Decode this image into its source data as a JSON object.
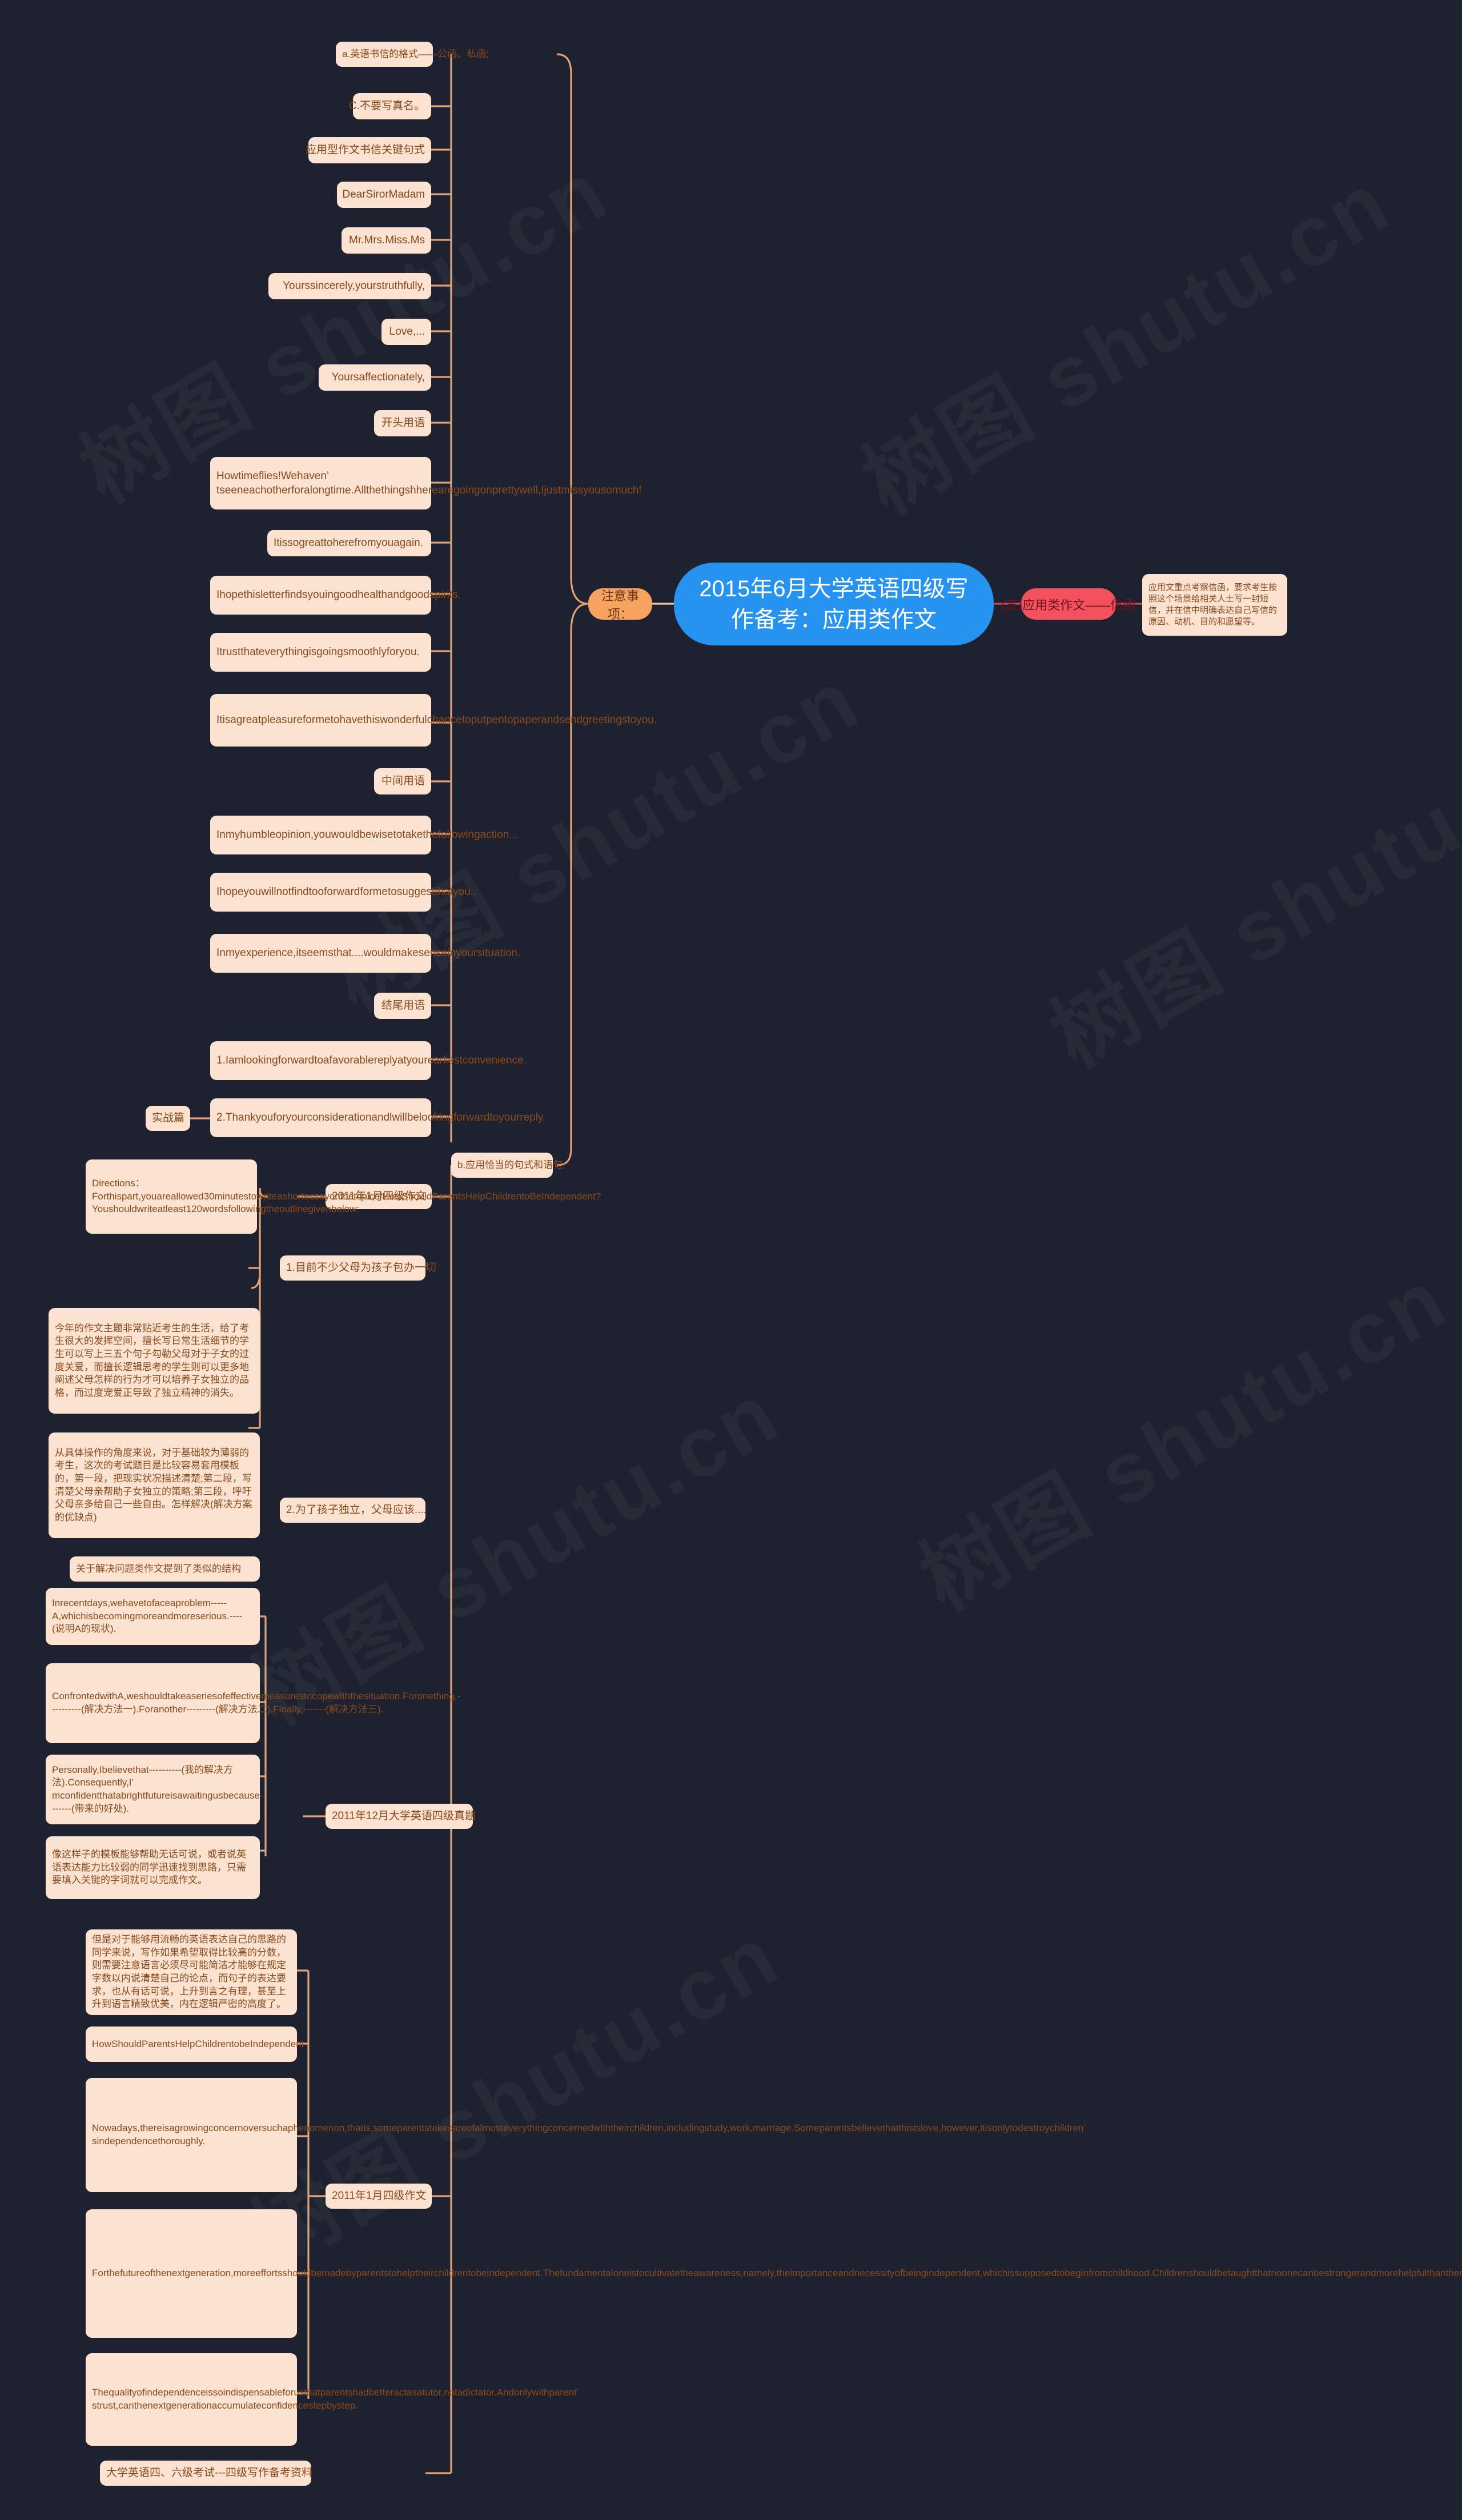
{
  "meta": {
    "background": "#1e2230",
    "root_color": "#2693f0",
    "branch_orange": "#f6a35f",
    "branch_red": "#f4515f",
    "card_bg": "#fce3d1",
    "card_text": "#8a4a1c",
    "link_orange": "#e2a273",
    "link_red": "#d9434f",
    "watermark": "树图 shutu.cn"
  },
  "root": {
    "title": "2015年6月大学英语四级写作备考：应用类作文"
  },
  "branches": {
    "notes": "注意事项：",
    "applied": "(五)应用类作文——信函"
  },
  "right_card": {
    "text": "应用文重点考察信函，要求考生按照这个场景给相关人士写一封短信，并在信中明确表达自己写信的原因、动机、目的和愿望等。"
  },
  "sub_branches": {
    "format": "a.英语书信的格式——公函、私函;",
    "sentences": "b.应用恰当的句式和语句;"
  },
  "format_children": [
    {
      "text": "C.不要写真名。"
    },
    {
      "text": "应用型作文书信关键句式"
    },
    {
      "text": "DearSirorMadam"
    },
    {
      "text": "Mr.Mrs.Miss.Ms"
    },
    {
      "text": "Yourssincerely,yourstruthfully,"
    },
    {
      "text": "Love,..."
    },
    {
      "text": "Yoursaffectionately,"
    },
    {
      "text": "开头用语"
    },
    {
      "text": "Howtimeflies!Wehaven’ tseeneachotherforalongtime.Allthethingshherearegoingonprettywell,Ijustmissyousomuch!"
    },
    {
      "text": "Itissogreattoherefromyouagain."
    },
    {
      "text": "Ihopethisletterfindsyouingoodhealthandgoodspirits."
    },
    {
      "text": "Itrustthateverythingisgoingsmoothlyforyou."
    },
    {
      "text": "Itisagreatpleasureformetohavethiswonderfulchancetoputpentopaperandsendgreetingstoyou."
    },
    {
      "text": "中间用语"
    },
    {
      "text": "Inmyhumbleopinion,youwouldbewisetotakethefollowingaction..."
    },
    {
      "text": "Ihopeyouwillnotfindtooforwardformetosuggestthatyou.."
    },
    {
      "text": "Inmyexperience,itseemsthat....wouldmakesenseinyoursituation."
    },
    {
      "text": "结尾用语"
    },
    {
      "text": "1.Iamlookingforwardtoafavorablereplyatyourearliestconvenience."
    },
    {
      "text": "2.Thankyouforyourconsiderationandlwillbelookingforwardtoyourreply."
    }
  ],
  "practice": {
    "label": "实战篇"
  },
  "exam_2011_01_a": {
    "label": "2011年1月四级作文"
  },
  "exam_2011_12": {
    "label": "2011年12月大学英语四级真题"
  },
  "exam_2011_01_b": {
    "label": "2011年1月四级作文"
  },
  "bottom": {
    "label": "大学英语四、六级考试---四级写作备考资料"
  },
  "exam_2011_01_a_children": [
    {
      "text": "Directions：Forthispart,youareallowed30minutestowriteashortessayonthetopicofHowShouldParentsHelpChildrentoBeIndependent?Youshouldwriteatleast120wordsfollowingtheoutlinegivenbelow:"
    },
    {
      "text": "1.目前不少父母为孩子包办一切"
    },
    {
      "text": "今年的作文主题非常贴近考生的生活，给了考生很大的发挥空间，擅长写日常生活细节的学生可以写上三五个句子勾勒父母对于子女的过度关爱，而擅长逻辑思考的学生则可以更多地阐述父母怎样的行为才可以培养子女独立的品格，而过度宠爱正导致了独立精神的消失。"
    },
    {
      "text": "从具体操作的角度来说，对于基础较为薄弱的考生，这次的考试题目是比较容易套用模板的，第一段，把现实状况描述清楚;第二段，写清楚父母亲帮助子女独立的策略;第三段，呼吁父母亲多给自己一些自由。怎样解决(解决方案的优缺点)"
    },
    {
      "text": "2.为了孩子独立，父母应该...."
    },
    {
      "text": "关于解决问题类作文提到了类似的结构"
    }
  ],
  "exam_2011_12_children": [
    {
      "text": "Inrecentdays,wehavetofaceaproblem-----A,whichisbecomingmoreandmoreserious.----(说明A的现状)."
    },
    {
      "text": "ConfrontedwithA,weshouldtakeaseriesofeffectivemeasurestocopewiththesituation.Foronething,----------(解决方法一).Foranother---------(解决方法二).Finally,-------(解决方法三)."
    },
    {
      "text": "Personally,Ibelievethat----------(我的解决方法).Consequently,I’ mconfidentthatabrightfutureisawaitingusbecause-------(带来的好处)."
    },
    {
      "text": "像这样子的模板能够帮助无话可说，或者说英语表达能力比较弱的同学迅速找到思路，只需要填入关键的字词就可以完成作文。"
    }
  ],
  "exam_2011_01_b_children": [
    {
      "text": "但是对于能够用流畅的英语表达自己的思路的同学来说，写作如果希望取得比较高的分数，则需要注意语言必须尽可能简洁才能够在规定字数以内说清楚自己的论点，而句子的表达要求，也从有话可说，上升到言之有理，甚至上升到语言精致优美，内在逻辑严密的高度了。"
    },
    {
      "text": "HowShouldParentsHelpChildrentobeIndependent"
    },
    {
      "text": "Nowadays,thereisagrowingconcernoversuchaphenomenon,thatis,someparentstakecareofalmosteverythingconcernedwiththeirchildren,includingstudy,work,marriage.Someparentsbelievethatthisislove,however,itisonlytodestroychildren’ sindependencethoroughly."
    },
    {
      "text": "Forthefutureofthenextgeneration,moreeffortsshouldbemadebyparentstohelptheirchildrentobeindependent.Thefundamentaloneistocultivatetheawareness,namely,theimportanceandnecessityofbeingindependent,whichissupposedtobeginfromchildhood.Childrenshouldbetaughtthatnoonecanbestrongerandmorehelpfulthanthemselvesinthisworld."
    },
    {
      "text": "Thequalityofindependenceissoindispensableforusthatparentshadbetteractasatutor,notadictator.Andonlywithparent’ strust,canthenextgenerationaccumulateconfidencestepbystep."
    }
  ]
}
